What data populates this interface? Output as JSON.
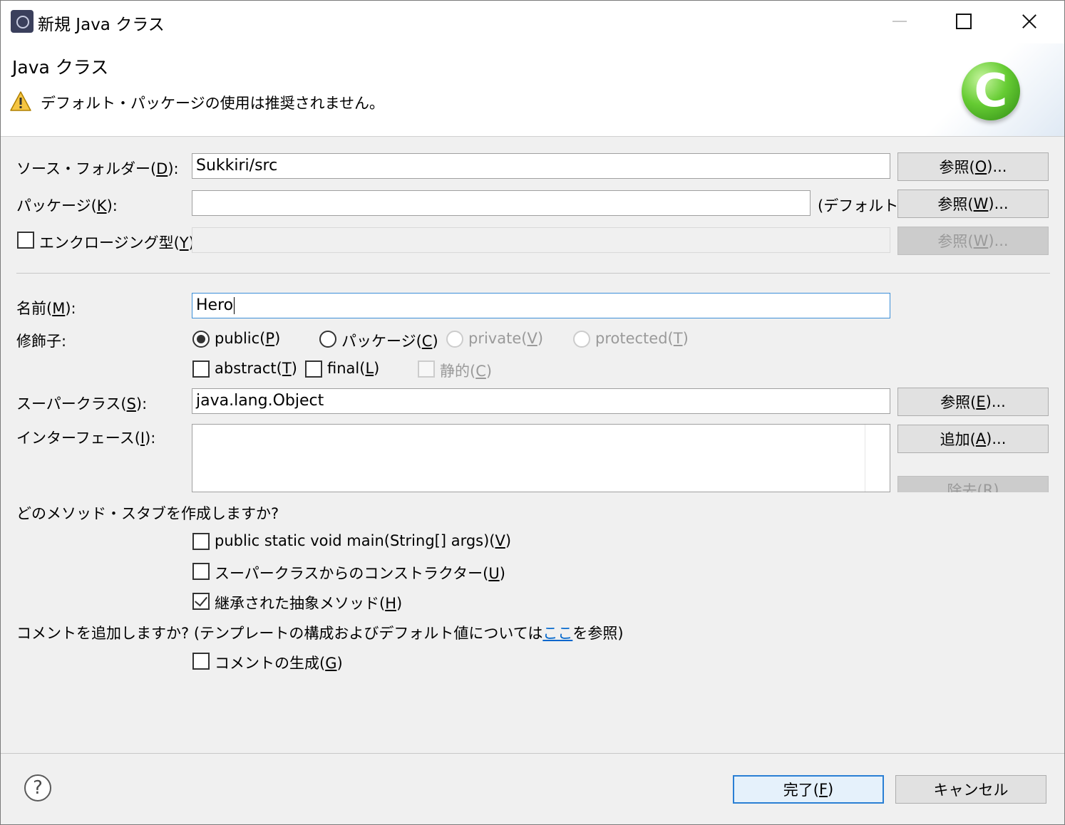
{
  "window": {
    "title": "新規 Java クラス",
    "app_icon": "eclipse-icon",
    "controls": {
      "minimize": "minimize-icon",
      "maximize": "maximize-icon",
      "close": "close-icon"
    }
  },
  "header": {
    "title": "Java クラス",
    "warning": "デフォルト・パッケージの使用は推奨されません。",
    "warning_icon": "warning-icon",
    "class_icon_letter": "C"
  },
  "source_folder": {
    "label": "ソース・フォルダー(",
    "mnemonic": "D",
    "label_end": "):",
    "value": "Sukkiri/src",
    "button": {
      "pre": "参照(",
      "mn": "O",
      "post": ")..."
    }
  },
  "package": {
    "label": "パッケージ(",
    "mnemonic": "K",
    "label_end": "):",
    "value": "",
    "default_text": "(デフォルト)",
    "button": {
      "pre": "参照(",
      "mn": "W",
      "post": ")..."
    }
  },
  "enclosing": {
    "label": "エンクロージング型(",
    "mnemonic": "Y",
    "label_end": "):",
    "checked": false,
    "value": "",
    "button": {
      "pre": "参照(",
      "mn": "W",
      "post": ")..."
    }
  },
  "name": {
    "label": "名前(",
    "mnemonic": "M",
    "label_end": "):",
    "value": "Hero"
  },
  "modifiers": {
    "label": "修飾子:",
    "radios": [
      {
        "pre": "public(",
        "mn": "P",
        "post": ")",
        "checked": true,
        "enabled": true
      },
      {
        "pre": "パッケージ(",
        "mn": "C",
        "post": ")",
        "checked": false,
        "enabled": true
      },
      {
        "pre": "private(",
        "mn": "V",
        "post": ")",
        "checked": false,
        "enabled": false
      },
      {
        "pre": "protected(",
        "mn": "T",
        "post": ")",
        "checked": false,
        "enabled": false
      }
    ],
    "checks": [
      {
        "pre": "abstract(",
        "mn": "T",
        "post": ")",
        "checked": false,
        "enabled": true
      },
      {
        "pre": "final(",
        "mn": "L",
        "post": ")",
        "checked": false,
        "enabled": true
      },
      {
        "pre": "静的(",
        "mn": "C",
        "post": ")",
        "checked": false,
        "enabled": false
      }
    ]
  },
  "superclass": {
    "label": "スーパークラス(",
    "mnemonic": "S",
    "label_end": "):",
    "value": "java.lang.Object",
    "button": {
      "pre": "参照(",
      "mn": "E",
      "post": ")..."
    }
  },
  "interfaces": {
    "label": "インターフェース(",
    "mnemonic": "I",
    "label_end": "):",
    "add_button": {
      "pre": "追加(",
      "mn": "A",
      "post": ")..."
    },
    "remove_button": {
      "pre": "除去(",
      "mn": "R",
      "post": ")"
    }
  },
  "stubs": {
    "question": "どのメソッド・スタブを作成しますか?",
    "items": [
      {
        "pre": "public static void main(String[] args)(",
        "mn": "V",
        "post": ")",
        "checked": false
      },
      {
        "pre": "スーパークラスからのコンストラクター(",
        "mn": "U",
        "post": ")",
        "checked": false
      },
      {
        "pre": "継承された抽象メソッド(",
        "mn": "H",
        "post": ")",
        "checked": true
      }
    ]
  },
  "comments": {
    "question_pre": "コメントを追加しますか? (テンプレートの構成およびデフォルト値については",
    "link_text": "ここ",
    "question_post": "を参照)",
    "generate": {
      "pre": "コメントの生成(",
      "mn": "G",
      "post": ")",
      "checked": false
    }
  },
  "footer": {
    "help_icon": "help-icon",
    "help_glyph": "?",
    "finish": {
      "pre": "完了(",
      "mn": "F",
      "post": ")"
    },
    "cancel": "キャンセル"
  }
}
